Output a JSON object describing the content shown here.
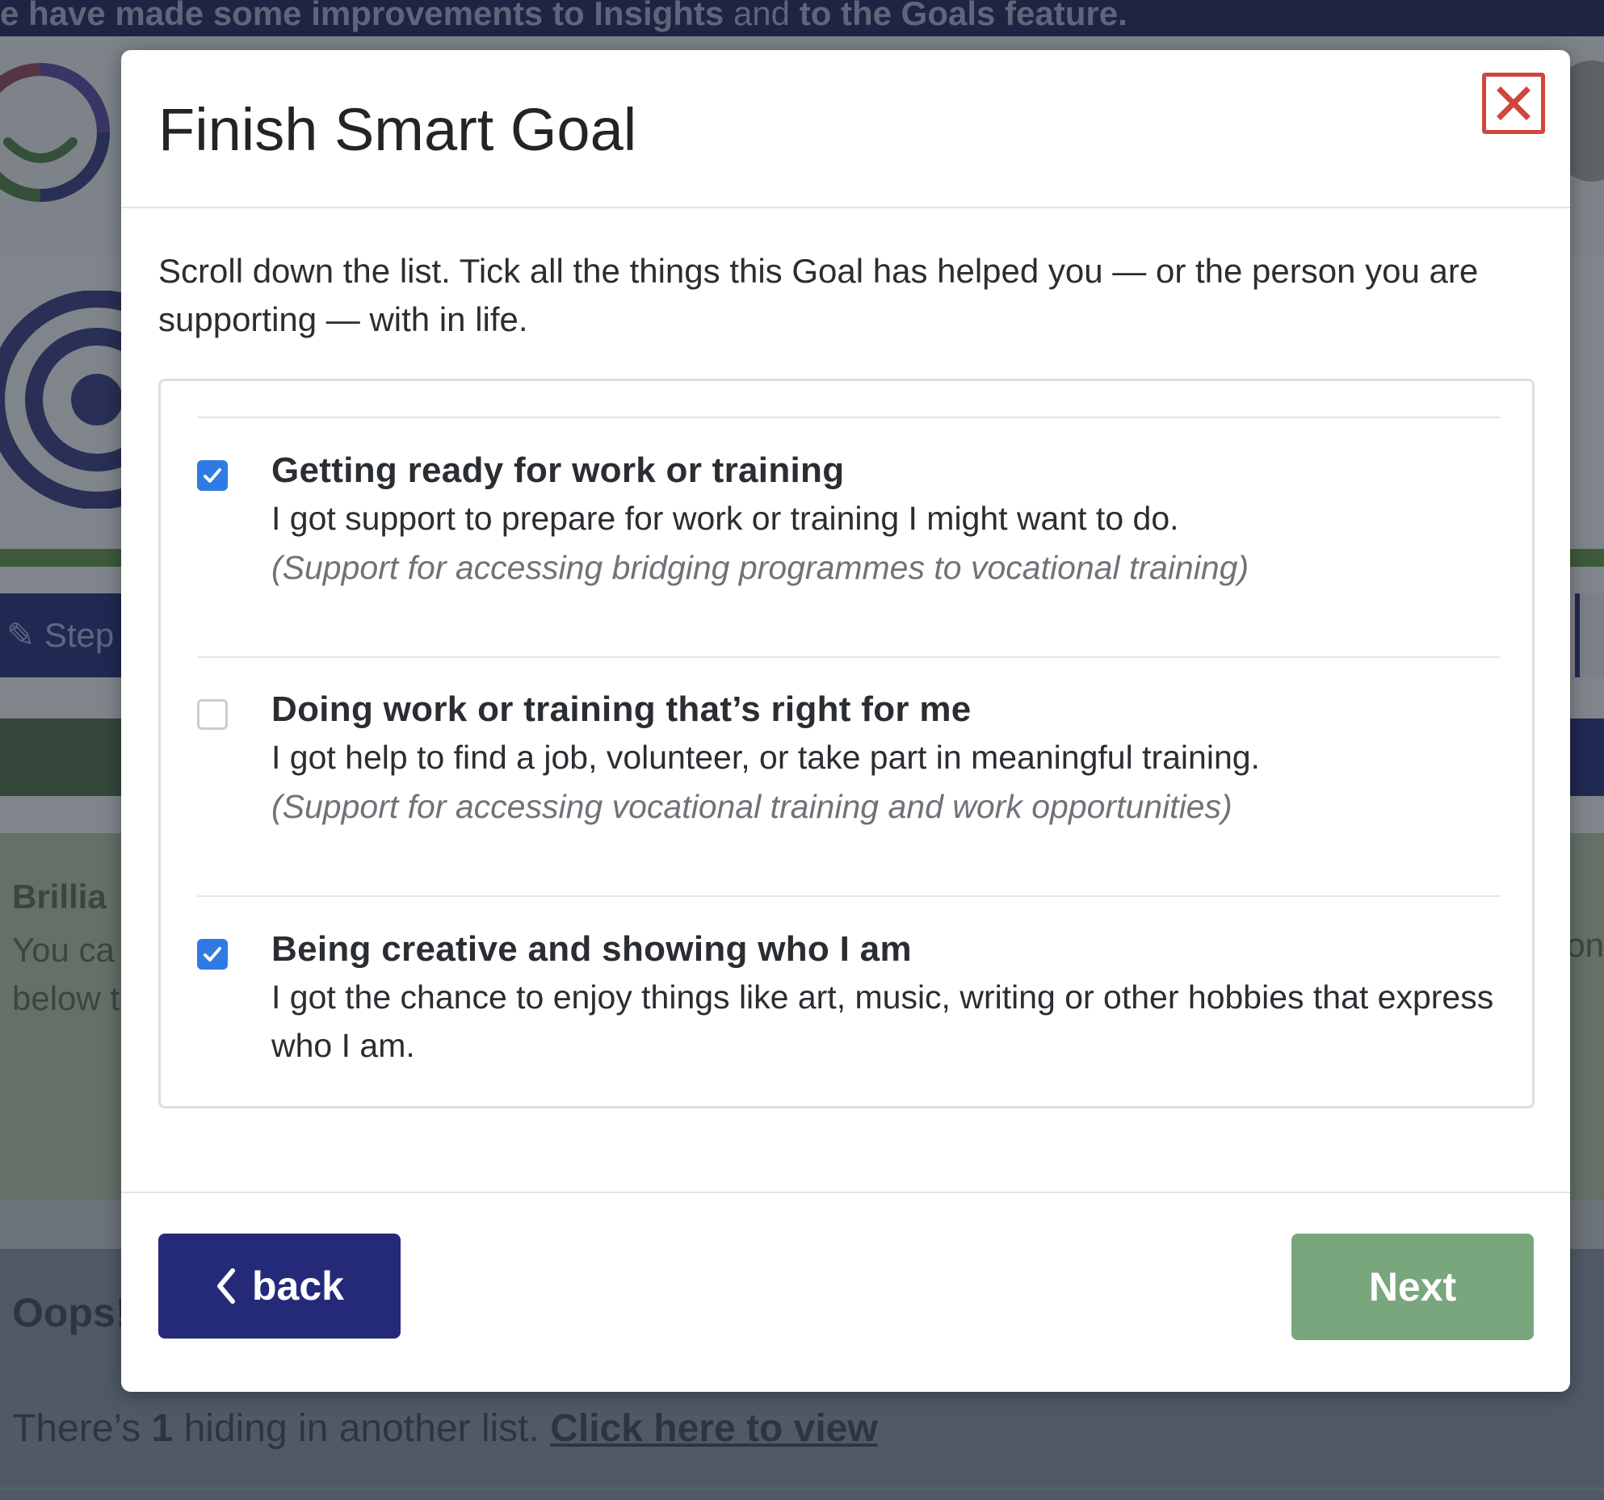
{
  "background": {
    "banner_text_bold_1": "e have made some improvements to Insights",
    "banner_text_muted": " and ",
    "banner_text_bold_2": "to the Goals feature.",
    "step_label": "Step",
    "success_title": "Brillia",
    "success_text_line1": "You ca",
    "success_text_line2": "below t",
    "success_text_right": "on",
    "oops_title": "Oops!",
    "oops_text_before": "There’s ",
    "oops_count": "1",
    "oops_text_after": " hiding in another list. ",
    "oops_link": "Click here to view"
  },
  "modal": {
    "title": "Finish Smart Goal",
    "close_icon": "close-x-icon",
    "intro": "Scroll down the list. Tick all the things this Goal has helped you — or the person you are supporting — with in life.",
    "items": [
      {
        "checked": true,
        "heading": "Getting ready for work or training",
        "description": "I got support to prepare for work or training I might want to do.",
        "note": "(Support for accessing bridging programmes to vocational training)"
      },
      {
        "checked": false,
        "heading": "Doing work or training that’s right for me",
        "description": "I got help to find a job, volunteer, or take part in meaningful training.",
        "note": "(Support for accessing vocational training and work opportunities)"
      },
      {
        "checked": true,
        "heading": "Being creative and showing who I am",
        "description": "I got the chance to enjoy things like art, music, writing or other hobbies that express who I am.",
        "note": ""
      }
    ],
    "back_label": "back",
    "next_label": "Next"
  },
  "colors": {
    "primary": "#252a78",
    "next": "#79a67d",
    "close": "#d0453d",
    "checkbox": "#2f7be3"
  }
}
